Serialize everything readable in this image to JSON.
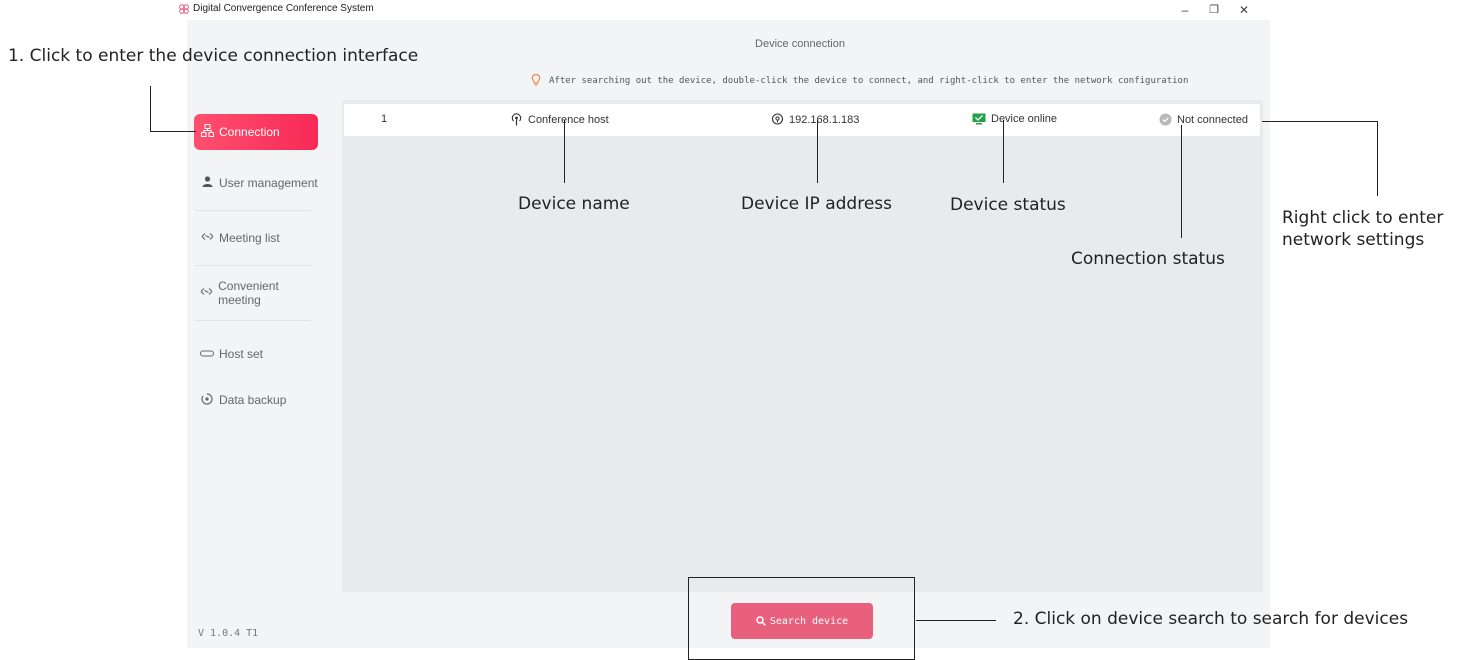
{
  "window": {
    "title": "Digital Convergence Conference System",
    "controls": {
      "minimize": "–",
      "restore": "❐",
      "close": "✕"
    }
  },
  "sidebar": {
    "items": [
      {
        "label": "Connection",
        "icon": "connection-icon",
        "active": true
      },
      {
        "label": "User management",
        "icon": "user-icon"
      },
      {
        "label": "Meeting list",
        "icon": "meeting-list-icon"
      },
      {
        "label": "Convenient meeting",
        "icon": "convenient-meeting-icon"
      },
      {
        "label": "Host set",
        "icon": "host-set-icon"
      },
      {
        "label": "Data backup",
        "icon": "data-backup-icon"
      }
    ],
    "version": "V 1.0.4 T1"
  },
  "main": {
    "title": "Device connection",
    "tip": "After searching out the device, double-click the device to connect, and right-click to enter the network configuration",
    "devices": [
      {
        "index": "1",
        "name": "Conference host",
        "ip": "192.168.1.183",
        "status": "Device online",
        "connection": "Not connected"
      }
    ],
    "search_button": "Search device"
  },
  "annotations": {
    "step1": "1. Click to enter the device connection interface",
    "device_name": "Device name",
    "device_ip": "Device IP address",
    "device_status": "Device status",
    "connection_status": "Connection status",
    "right_click_line1": "Right click to enter",
    "right_click_line2": "network settings",
    "step2": "2. Click on device search to search for devices"
  },
  "colors": {
    "accent": "#f72a56",
    "button": "#e9607e",
    "online": "#22a045",
    "tip_icon": "#f08a4b"
  }
}
